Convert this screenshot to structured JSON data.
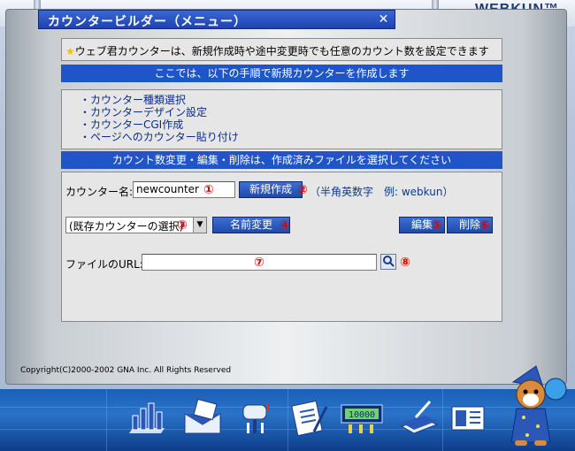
{
  "app": {
    "brand": "WEBKUN™",
    "window_title": "カウンタービルダー（メニュー）",
    "close_label": "✕"
  },
  "notice": {
    "star": "★",
    "text": "ウェブ君カウンターは、新規作成時や途中変更時でも任意のカウント数を設定できます"
  },
  "bands": {
    "steps_header": "ここでは、以下の手順で新規カウンターを作成します",
    "edit_header": "カウント数変更・編集・削除は、作成済みファイルを選択してください"
  },
  "steps": [
    "・カウンター種類選択",
    "・カウンターデザイン設定",
    "・カウンターCGI作成",
    "・ページへのカウンター貼り付け"
  ],
  "form": {
    "counter_name_label": "カウンター名:",
    "counter_name_value": "newcounter",
    "marker_1": "①",
    "new_button": "新規作成",
    "marker_2": "②",
    "hint": "（半角英数字　例: webkun）",
    "select_value": "(既存カウンターの選択)",
    "marker_3": "③",
    "rename_button": "名前変更",
    "marker_4": "④",
    "edit_button": "編集",
    "marker_5": "⑤",
    "delete_button": "削除",
    "marker_6": "⑥",
    "url_label": "ファイルのURL:",
    "url_value": "",
    "marker_7": "⑦",
    "marker_8": "⑧"
  },
  "copyright": "Copyright(C)2000-2002 GNA Inc. All Rights Reserved",
  "toolbar_icons": [
    "bar-chart-icon",
    "mail-icon",
    "mailbox-icon",
    "clipboard-icon",
    "counter-display-icon",
    "book-icon",
    "cards-icon"
  ],
  "colors": {
    "title_blue": "#1d43b0",
    "band_blue": "#1f55c8",
    "marker_red": "#e00000",
    "link_blue": "#0a2c8f"
  }
}
